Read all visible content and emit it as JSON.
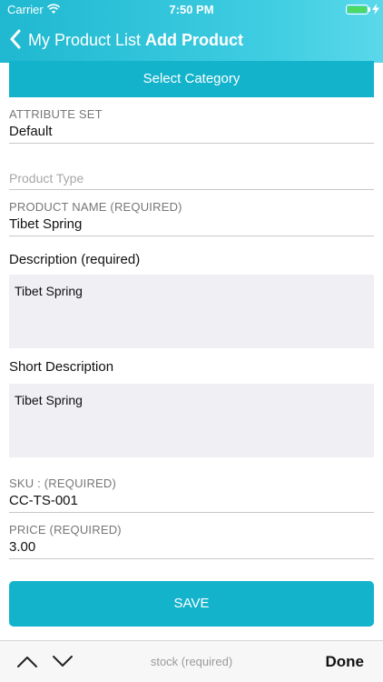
{
  "status_bar": {
    "carrier": "Carrier",
    "time": "7:50 PM",
    "icons": [
      "wifi-icon",
      "battery-icon",
      "charging-icon"
    ],
    "battery_color": "#4cd964"
  },
  "nav": {
    "back_label": "My Product List",
    "title": "Add Product",
    "back_icon": "chevron-left-icon"
  },
  "form": {
    "select_category_label": "Select Category",
    "attribute_set": {
      "label": "ATTRIBUTE SET",
      "value": "Default"
    },
    "product_type": {
      "placeholder": "Product Type"
    },
    "product_name": {
      "label": "PRODUCT NAME (REQUIRED)",
      "value": "Tibet Spring"
    },
    "description": {
      "label": "Description (required)",
      "value": "Tibet Spring"
    },
    "short_description": {
      "label": "Short Description",
      "value": "Tibet Spring"
    },
    "sku": {
      "label": "SKU : (REQUIRED)",
      "value": "CC-TS-001"
    },
    "price": {
      "label": "PRICE  (REQUIRED)",
      "value": "3.00"
    },
    "save_label": "SAVE"
  },
  "toolbar": {
    "up_icon": "chevron-up-icon",
    "down_icon": "chevron-down-icon",
    "hint": "stock (required)",
    "done_label": "Done"
  },
  "colors": {
    "accent": "#13b3cc",
    "header_gradient": [
      "#1fb8d0",
      "#5ad8ea"
    ],
    "field_bg": "#efeff4"
  }
}
